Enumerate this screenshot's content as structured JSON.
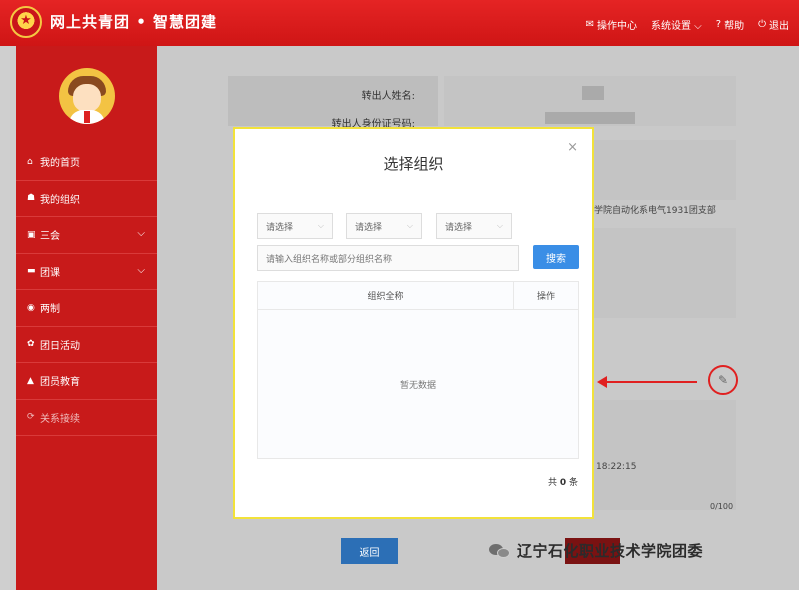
{
  "header": {
    "brand": "网上共青团 • 智慧团建",
    "nav": [
      {
        "icon": "envelope-icon",
        "glyph": "✉",
        "label": "操作中心"
      },
      {
        "icon": "chevron-down-icon",
        "glyph": "",
        "label": "系统设置 ⌵"
      },
      {
        "icon": "help-icon",
        "glyph": "?",
        "label": "帮助"
      },
      {
        "icon": "power-icon",
        "glyph": "⏻",
        "label": "退出"
      }
    ]
  },
  "sidebar": {
    "items": [
      {
        "label": "我的首页",
        "glyph": "⌂"
      },
      {
        "label": "我的组织",
        "glyph": "☗"
      },
      {
        "label": "三会",
        "glyph": "▣",
        "chevron": "⌵"
      },
      {
        "label": "团课",
        "glyph": "▬",
        "chevron": "⌵"
      },
      {
        "label": "两制",
        "glyph": "◉"
      },
      {
        "label": "团日活动",
        "glyph": "✿"
      },
      {
        "label": "团员教育",
        "glyph": "▲"
      },
      {
        "label": "关系接续",
        "glyph": "⟳"
      }
    ]
  },
  "background": {
    "label1": "转出人姓名:",
    "label2": "转出人身份证号码:",
    "text_dept": "学院自动化系电气1931团支部",
    "text_time": "18:22:15",
    "text_count": "0/100",
    "return_label": "返回"
  },
  "modal": {
    "title": "选择组织",
    "close": "×",
    "selects": [
      "请选择",
      "请选择",
      "请选择"
    ],
    "search_placeholder": "请输入组织名称或部分组织名称",
    "search_button": "搜索",
    "columns": [
      "组织全称",
      "操作"
    ],
    "empty_text": "暂无数据",
    "total_prefix": "共",
    "total_count": "0",
    "total_suffix": "条"
  },
  "watermark": {
    "text": "辽宁石化职业技术学院团委"
  },
  "colors": {
    "header_red": "#e52424",
    "sidebar_red": "#c81a1a",
    "primary_blue": "#3a8ee6",
    "highlight_yellow": "#f2e23a",
    "annotation_red": "#e02020"
  }
}
